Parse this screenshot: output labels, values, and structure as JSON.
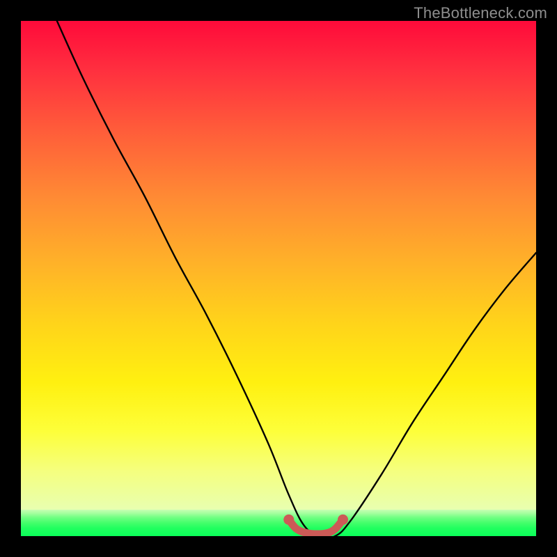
{
  "watermark": "TheBottleneck.com",
  "chart_data": {
    "type": "line",
    "title": "",
    "xlabel": "",
    "ylabel": "",
    "xlim": [
      0,
      100
    ],
    "ylim": [
      0,
      100
    ],
    "note": "V-shaped bottleneck curve over a vertical red→yellow→green gradient; valley ≈ x 53–62 at y≈0; left arm reaches y≈100 near x≈7; right arm reaches y≈55 at x=100.",
    "series": [
      {
        "name": "curve",
        "x": [
          7,
          12,
          18,
          24,
          30,
          36,
          42,
          48,
          52,
          55,
          58,
          61,
          64,
          70,
          76,
          82,
          88,
          94,
          100
        ],
        "y": [
          100,
          89,
          77,
          66,
          54,
          43,
          31,
          18,
          8,
          2,
          0,
          0,
          3,
          12,
          22,
          31,
          40,
          48,
          55
        ]
      },
      {
        "name": "valley-marker",
        "x": [
          52,
          53.5,
          55.5,
          57.5,
          59.5,
          61,
          62.5
        ],
        "y": [
          3.2,
          1.4,
          0.6,
          0.4,
          0.6,
          1.4,
          3.2
        ]
      }
    ],
    "colors": {
      "curve": "#000000",
      "marker": "#cc5a57",
      "background_top": "#ff0a3a",
      "background_mid": "#ffd41a",
      "background_bottom": "#0aff59"
    }
  }
}
